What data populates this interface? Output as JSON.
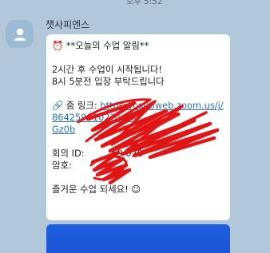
{
  "timestamp_prev": "오후 5:52",
  "sender": {
    "name": "챗사피엔스",
    "avatar_icon": "person-silhouette-icon"
  },
  "message": {
    "title": "**오늘의 수업 알림**",
    "title_icon": "⏰",
    "line_a": "2시간 후 수업이 시작됩니다!",
    "line_b": "8시 5분전 입장 부탁드립니다",
    "zoom_label": "줌 링크: ",
    "zoom_label_icon": "🔗",
    "zoom_url_1": "https://us06web.zoom.us/j/",
    "zoom_url_2": "8642590102?pwd=",
    "zoom_url_3": "Gz0b",
    "meeting_id_label": "회의 ID: ",
    "meeting_id_value": "59 028",
    "password_label": "암호: ",
    "closing": "즐거운 수업 되세요! ☺"
  },
  "colors": {
    "chat_bg": "#b2c7d9",
    "bubble_bg": "#ffffff",
    "link": "#2f6fb5",
    "redaction": "#e01515",
    "next_bubble": "#1a55d6"
  }
}
